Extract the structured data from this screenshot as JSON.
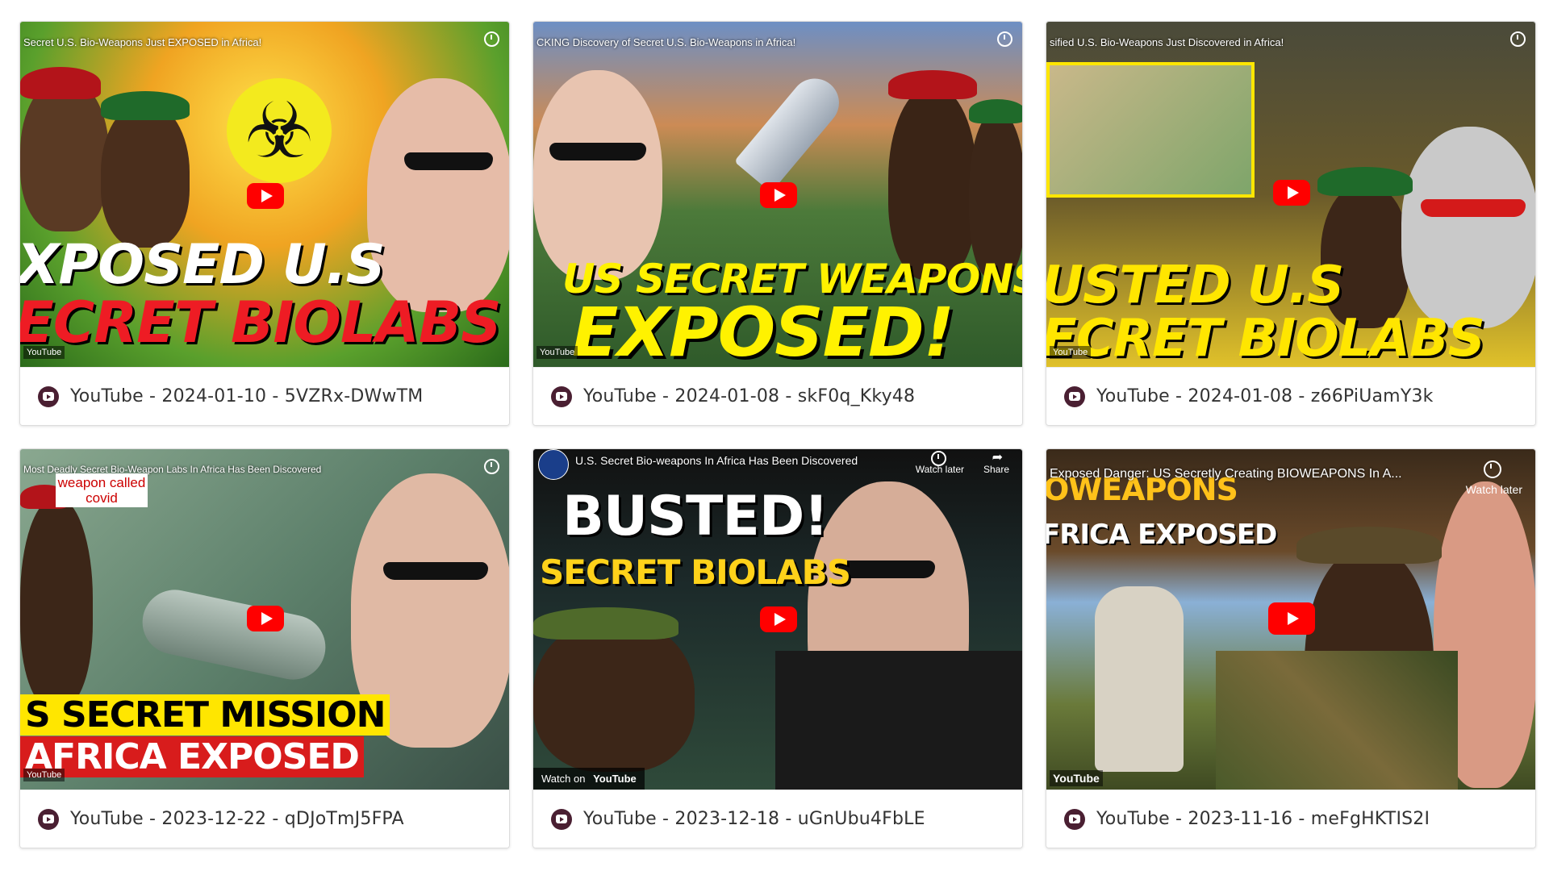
{
  "cards": [
    {
      "caption": "YouTube - 2024-01-10 - 5VZRx-DWwTM",
      "video_title": "Secret U.S. Bio-Weapons Just EXPOSED in Africa!",
      "line1": "XPOSED U.S",
      "line2": "ECRET BIOLABS",
      "logo": "YouTube"
    },
    {
      "caption": "YouTube - 2024-01-08 - skF0q_Kky48",
      "video_title": "CKING Discovery of Secret U.S. Bio-Weapons in Africa!",
      "line1": "US SECRET WEAPONS",
      "line2": "EXPOSED!",
      "logo": "YouTube"
    },
    {
      "caption": "YouTube - 2024-01-08 - z66PiUamY3k",
      "video_title": "sified U.S. Bio-Weapons Just Discovered in Africa!",
      "line1": "USTED U.S",
      "line2": "ECRET BIOLABS",
      "logo": "YouTube"
    },
    {
      "caption": "YouTube - 2023-12-22 - qDJoTmJ5FPA",
      "video_title": "Most Deadly Secret Bio-Weapon Labs In Africa Has Been Discovered",
      "overlay": "weapon called covid",
      "line1": "S SECRET MISSION",
      "line2": "AFRICA EXPOSED",
      "logo": "YouTube"
    },
    {
      "caption": "YouTube - 2023-12-18 - uGnUbu4FbLE",
      "video_title": "U.S. Secret Bio-weapons In Africa Has Been Discovered",
      "watch_later": "Watch later",
      "share": "Share",
      "line1": "BUSTED!",
      "line2": "SECRET BIOLABS",
      "watch_on": "Watch on",
      "logo": "YouTube"
    },
    {
      "caption": "YouTube - 2023-11-16 - meFgHKTIS2I",
      "video_title": "Exposed Danger: US Secretly Creating BIOWEAPONS In A...",
      "watch_later": "Watch later",
      "line1": "OWEAPONS",
      "line2": "FRICA EXPOSED",
      "logo": "YouTube"
    }
  ],
  "colors": {
    "youtube_red": "#ff0000",
    "source_icon": "#4a1f32",
    "caption_text": "#333333"
  }
}
